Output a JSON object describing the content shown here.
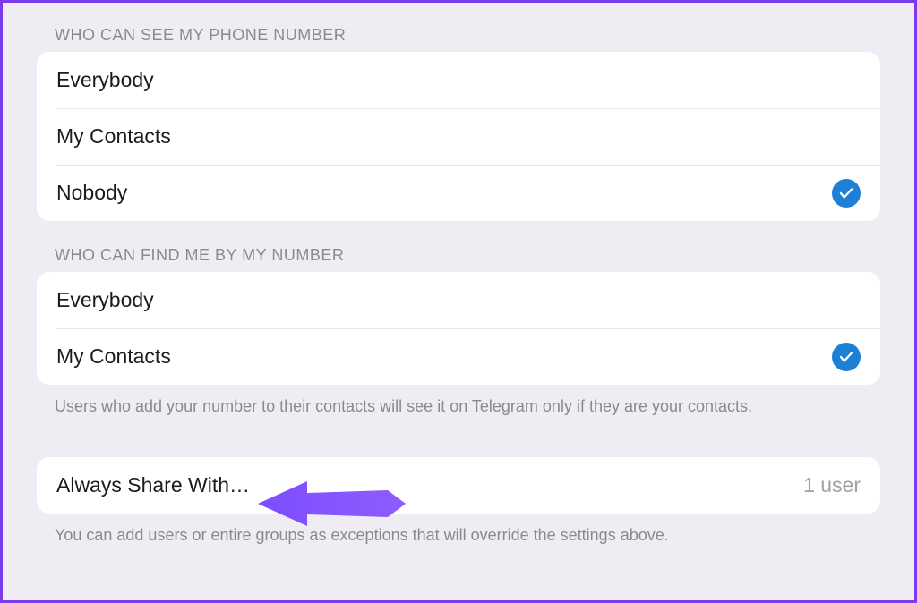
{
  "section1": {
    "header": "WHO CAN SEE MY PHONE NUMBER",
    "items": [
      {
        "label": "Everybody",
        "selected": false
      },
      {
        "label": "My Contacts",
        "selected": false
      },
      {
        "label": "Nobody",
        "selected": true
      }
    ]
  },
  "section2": {
    "header": "WHO CAN FIND ME BY MY NUMBER",
    "items": [
      {
        "label": "Everybody",
        "selected": false
      },
      {
        "label": "My Contacts",
        "selected": true
      }
    ],
    "footer": "Users who add your number to their contacts will see it on Telegram only if they are your contacts."
  },
  "section3": {
    "item": {
      "label": "Always Share With…",
      "value": "1 user"
    },
    "footer": "You can add users or entire groups as exceptions that will override the settings above."
  },
  "colors": {
    "accent": "#1e7fd6",
    "annotation": "#7c4dff"
  }
}
